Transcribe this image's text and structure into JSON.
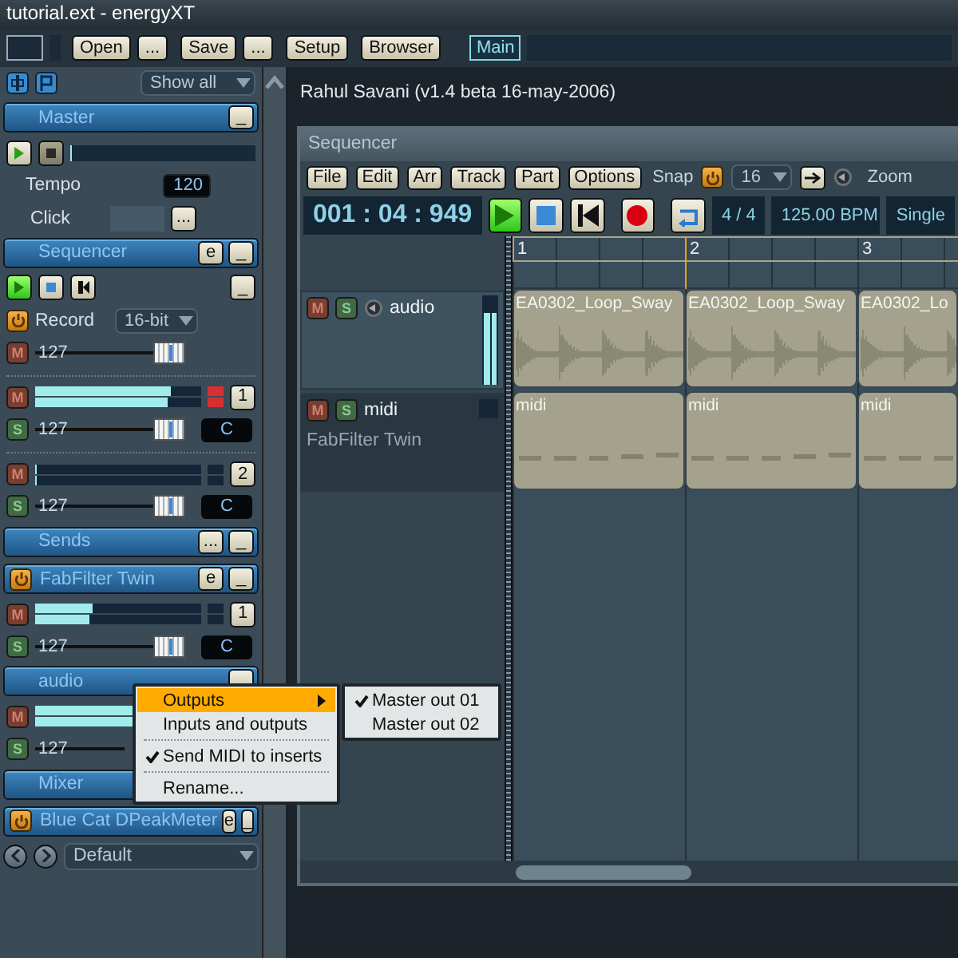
{
  "window": {
    "title": "tutorial.ext - energyXT"
  },
  "toolbar": {
    "buttons": [
      {
        "label": "Open"
      },
      {
        "label": "..."
      },
      {
        "label": "Save"
      },
      {
        "label": "..."
      },
      {
        "label": "Setup"
      },
      {
        "label": "Browser"
      }
    ],
    "tabs": [
      {
        "label": "Main",
        "selected": true
      }
    ]
  },
  "left_panel": {
    "filter": {
      "value": "Show all"
    },
    "items": [
      {
        "kind": "header",
        "title": "Master",
        "power": false,
        "buttons": [
          {
            "label": "_"
          }
        ]
      },
      {
        "kind": "transport",
        "buttons": [
          {
            "kind": "play",
            "active": false
          },
          {
            "kind": "stop",
            "active": true
          }
        ],
        "progress": {
          "level": 0.01
        }
      },
      {
        "kind": "value",
        "label": "Tempo",
        "value": "120"
      },
      {
        "kind": "field",
        "label": "Click",
        "button": {
          "label": "..."
        }
      },
      {
        "kind": "header",
        "title": "Sequencer",
        "power": false,
        "buttons": [
          {
            "label": "e"
          },
          {
            "label": "_"
          }
        ]
      },
      {
        "kind": "transport",
        "buttons": [
          {
            "kind": "play",
            "active": true
          },
          {
            "kind": "stop",
            "active": false
          },
          {
            "kind": "rewind",
            "active": false
          }
        ],
        "button": {
          "label": "_"
        }
      },
      {
        "kind": "dropdown",
        "power": true,
        "label": "Record",
        "value": "16-bit"
      },
      {
        "kind": "fader",
        "toggle": {
          "label": "M",
          "kind": "mute"
        },
        "value": "127",
        "level": 1.0
      },
      {
        "kind": "separator"
      },
      {
        "kind": "meter",
        "toggle": {
          "label": "M",
          "kind": "mute"
        },
        "meters": [
          {
            "level": 0.82
          },
          {
            "level": 0.8
          }
        ],
        "clip": true,
        "number": "1"
      },
      {
        "kind": "fader",
        "toggle": {
          "label": "S",
          "kind": "solo"
        },
        "value": "127",
        "level": 1.0,
        "tag": "C"
      },
      {
        "kind": "separator"
      },
      {
        "kind": "meter",
        "toggle": {
          "label": "M",
          "kind": "mute"
        },
        "meters": [
          {
            "level": 0.01
          },
          {
            "level": 0.01
          }
        ],
        "clip": false,
        "number": "2"
      },
      {
        "kind": "fader",
        "toggle": {
          "label": "S",
          "kind": "solo"
        },
        "value": "127",
        "level": 1.0,
        "tag": "C"
      },
      {
        "kind": "header",
        "title": "Sends",
        "power": false,
        "buttons": [
          {
            "label": "..."
          },
          {
            "label": "_"
          }
        ]
      },
      {
        "kind": "header",
        "title": "FabFilter Twin",
        "power": true,
        "buttons": [
          {
            "label": "e"
          },
          {
            "label": "_"
          }
        ]
      },
      {
        "kind": "meter",
        "toggle": {
          "label": "M",
          "kind": "mute"
        },
        "meters": [
          {
            "level": 0.35
          },
          {
            "level": 0.33
          }
        ],
        "clip": false,
        "number": "1"
      },
      {
        "kind": "fader",
        "toggle": {
          "label": "S",
          "kind": "solo"
        },
        "value": "127",
        "level": 1.0,
        "tag": "C"
      },
      {
        "kind": "header",
        "title": "audio",
        "power": false,
        "buttons": [
          {
            "kind": "blank"
          }
        ]
      },
      {
        "kind": "meter",
        "toggle": {
          "label": "M",
          "kind": "mute"
        },
        "meters": [
          {
            "level": 0.8
          },
          {
            "level": 0.8
          }
        ]
      },
      {
        "kind": "fader",
        "toggle": {
          "label": "S",
          "kind": "solo"
        },
        "value": "127"
      },
      {
        "kind": "header",
        "title": "Mixer",
        "power": false
      },
      {
        "kind": "header",
        "title": "Blue Cat DPeakMeter",
        "power": true,
        "buttons": [
          {
            "label": "e"
          },
          {
            "label": "_"
          }
        ]
      }
    ],
    "preset": {
      "value": "Default"
    }
  },
  "credit": "Rahul Savani (v1.4 beta 16-may-2006)",
  "sequencer": {
    "title": "Sequencer",
    "menu": [
      {
        "label": "File"
      },
      {
        "label": "Edit"
      },
      {
        "label": "Arr"
      },
      {
        "label": "Track"
      },
      {
        "label": "Part"
      },
      {
        "label": "Options"
      }
    ],
    "snap": {
      "label": "Snap",
      "power": true,
      "value": "16"
    },
    "zoom_label": "Zoom",
    "time": "001 : 04 : 949",
    "transport": [
      {
        "kind": "play",
        "active": true
      },
      {
        "kind": "stop",
        "active": false
      },
      {
        "kind": "rewind",
        "active": false
      },
      {
        "kind": "record",
        "active": false
      },
      {
        "kind": "loop",
        "active": false
      }
    ],
    "signature": "4 / 4",
    "tempo": "125.00 BPM",
    "mode": "Single",
    "ruler": [
      "1",
      "2",
      "3"
    ],
    "tracks": [
      {
        "kind": "audio",
        "name": "audio",
        "toggles": [
          {
            "label": "M",
            "kind": "mute"
          },
          {
            "label": "S",
            "kind": "solo"
          }
        ],
        "meter": {
          "level": 0.8
        },
        "clips": [
          "EA0302_Loop_Sway",
          "EA0302_Loop_Sway",
          "EA0302_Lo"
        ]
      },
      {
        "kind": "midi",
        "name": "midi",
        "toggles": [
          {
            "label": "M",
            "kind": "mute"
          },
          {
            "label": "S",
            "kind": "solo"
          }
        ],
        "instrument": "FabFilter Twin",
        "clips": [
          "midi",
          "midi",
          "midi"
        ]
      }
    ]
  },
  "context_menu": {
    "items": [
      {
        "kind": "item",
        "label": "Outputs",
        "selected": true,
        "checked": false,
        "submenu": true
      },
      {
        "kind": "item",
        "label": "Inputs and outputs",
        "selected": false,
        "checked": false,
        "submenu": false
      },
      {
        "kind": "separator"
      },
      {
        "kind": "item",
        "label": "Send MIDI to inserts",
        "selected": false,
        "checked": true,
        "submenu": false
      },
      {
        "kind": "separator"
      },
      {
        "kind": "item",
        "label": "Rename...",
        "selected": false,
        "checked": false,
        "submenu": false
      }
    ],
    "submenu": [
      {
        "label": "Master out 01",
        "checked": true
      },
      {
        "label": "Master out 02",
        "checked": false
      }
    ]
  }
}
